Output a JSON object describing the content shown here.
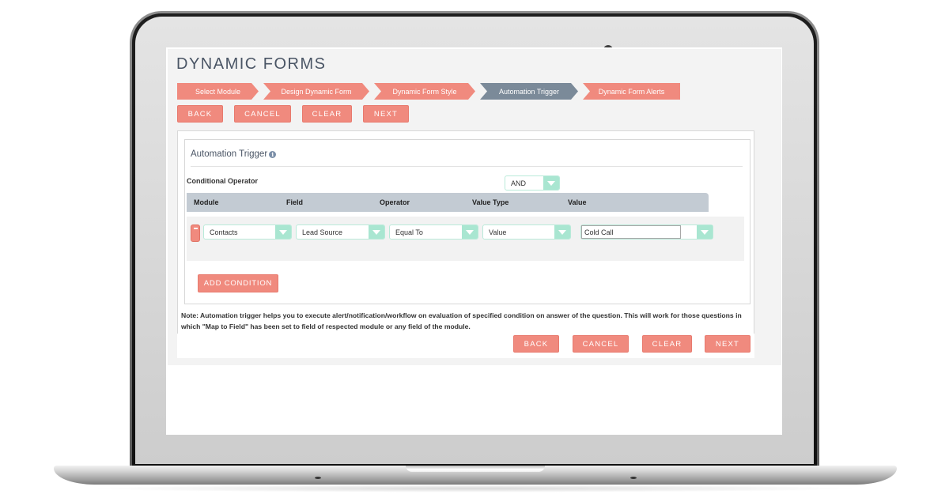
{
  "app": {
    "title": "DYNAMIC FORMS"
  },
  "steps": [
    {
      "label": "Select Module",
      "active": false
    },
    {
      "label": "Design Dynamic Form",
      "active": false
    },
    {
      "label": "Dynamic Form Style",
      "active": false
    },
    {
      "label": "Automation Trigger",
      "active": true
    },
    {
      "label": "Dynamic Form Alerts",
      "active": false
    }
  ],
  "top_buttons": {
    "back": "BACK",
    "cancel": "CANCEL",
    "clear": "CLEAR",
    "next": "NEXT"
  },
  "panel": {
    "heading": "Automation Trigger",
    "info_icon": "info-icon",
    "conditional_operator_label": "Conditional Operator",
    "conditional_operator_value": "AND",
    "columns": [
      "Module",
      "Field",
      "Operator",
      "Value Type",
      "Value"
    ],
    "conditions": [
      {
        "module": "Contacts",
        "field": "Lead Source",
        "operator": "Equal To",
        "value_type": "Value",
        "value": "Cold Call"
      }
    ],
    "add_condition_label": "ADD CONDITION"
  },
  "note": "Note: Automation trigger helps you to execute alert/notification/workflow on evaluation of specified condition on answer of the question. This will work for those questions in which \"Map to Field\" has been set to field of respected module or any field of the module.",
  "bottom_buttons": {
    "back": "BACK",
    "cancel": "CANCEL",
    "clear": "CLEAR",
    "next": "NEXT"
  },
  "colors": {
    "accent_button": "#f08a7e",
    "active_step": "#7b8a99",
    "select_arrow": "#a9e6d1",
    "table_header": "#c3cbd3"
  }
}
